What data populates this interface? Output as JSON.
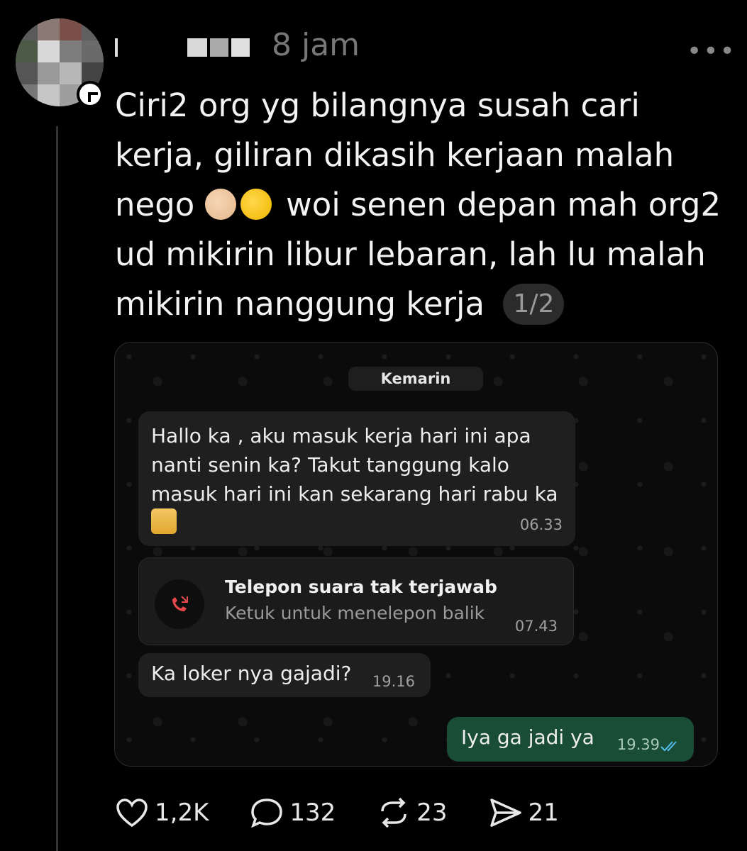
{
  "post": {
    "time": "8 jam",
    "more_icon": "more-horizontal-icon",
    "text": "Ciri2 org yg bilangnya susah cari kerja, giliran dikasih kerjaan malah nego",
    "text_part2": "woi senen depan mah org2 ud mikirin libur lebaran, lah lu malah mikirin nanggung kerja",
    "page_indicator": "1/2"
  },
  "chat": {
    "date_chip": "Kemarin",
    "messages": [
      {
        "text": "Hallo ka , aku masuk kerja hari ini apa nanti senin ka? Takut tanggung kalo masuk hari ini kan sekarang hari rabu ka",
        "time": "06.33"
      },
      {
        "call_title": "Telepon suara tak terjawab",
        "call_sub": "Ketuk untuk menelepon balik",
        "time": "07.43"
      },
      {
        "text": "Ka loker nya gajadi?",
        "time": "19.16"
      },
      {
        "text": "Iya ga jadi ya",
        "time": "19.39"
      }
    ],
    "colors": {
      "outgoing": "#1a4d36",
      "incoming": "#1f1f1f",
      "missed_call": "#e5484d",
      "read_ticks": "#53bdeb"
    }
  },
  "actions": {
    "like_count": "1,2K",
    "reply_count": "132",
    "repost_count": "23",
    "share_count": "21"
  }
}
